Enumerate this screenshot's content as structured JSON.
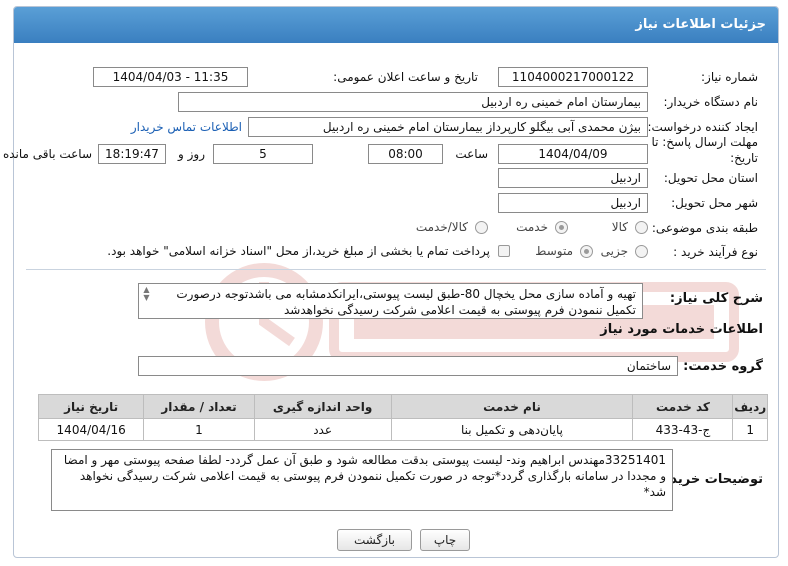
{
  "header": {
    "title": "جزئیات اطلاعات نیاز"
  },
  "fields": {
    "need_number_label": "شماره نیاز:",
    "need_number": "1104000217000122",
    "announce_label": "تاریخ و ساعت اعلان عمومی:",
    "announce_value": "1404/04/03 - 11:35",
    "buyer_org_label": "نام دستگاه خریدار:",
    "buyer_org": "بیمارستان امام خمینی  ره  اردبیل",
    "requester_label": "ایجاد کننده درخواست:",
    "requester": "بیژن محمدی آبی بیگلو کارپرداز بیمارستان امام خمینی  ره  اردبیل",
    "contact_link": "اطلاعات تماس خریدار",
    "deadline_label_1": "مهلت ارسال پاسخ: تا",
    "deadline_label_2": "تاریخ:",
    "deadline_date": "1404/04/09",
    "time_label": "ساعت",
    "deadline_time": "08:00",
    "days_value": "5",
    "days_label": "روز و",
    "remaining_time": "18:19:47",
    "remaining_label": "ساعت باقی مانده",
    "province_label": "استان محل تحویل:",
    "province": "اردبیل",
    "city_label": "شهر محل تحویل:",
    "city": "اردبیل",
    "category_label": "طبقه بندی موضوعی:",
    "category_options": [
      "کالا",
      "خدمت",
      "کالا/خدمت"
    ],
    "process_label": "نوع فرآیند خرید :",
    "process_options": [
      "جزیی",
      "متوسط"
    ],
    "payment_note": "پرداخت تمام یا بخشی از مبلغ خرید،از محل \"اسناد خزانه اسلامی\" خواهد بود."
  },
  "summary": {
    "label": "شرح کلی نیاز:",
    "text": "تهیه و آماده سازی محل یخچال 80-طبق لیست پیوستی،ایرانکدمشابه می باشدتوجه درصورت تکمیل ننمودن فرم پیوستی به قیمت اعلامی شرکت رسیدگی نخواهدشد"
  },
  "services": {
    "section_title": "اطلاعات خدمات مورد نیاز",
    "group_label": "گروه خدمت:",
    "group_value": "ساختمان",
    "columns": [
      "ردیف",
      "کد خدمت",
      "نام خدمت",
      "واحد اندازه گیری",
      "تعداد / مقدار",
      "تاریخ نیاز"
    ],
    "rows": [
      [
        "1",
        "ج-43-433",
        "پایان‌دهی و تکمیل بنا",
        "عدد",
        "1",
        "1404/04/16"
      ]
    ]
  },
  "buyer_notes": {
    "label": "توضیحات خریدار:",
    "text": "33251401مهندس ابراهیم وند- لیست پیوستی بدقت مطالعه شود و طبق آن عمل گردد- لطفا صفحه پیوستی مهر و امضا و مجددا در سامانه بارگذاری گردد*توجه در صورت تکمیل ننمودن فرم پیوستی به قیمت اعلامی شرکت رسیدگی نخواهد شد*"
  },
  "buttons": {
    "print": "چاپ",
    "back": "بازگشت"
  }
}
